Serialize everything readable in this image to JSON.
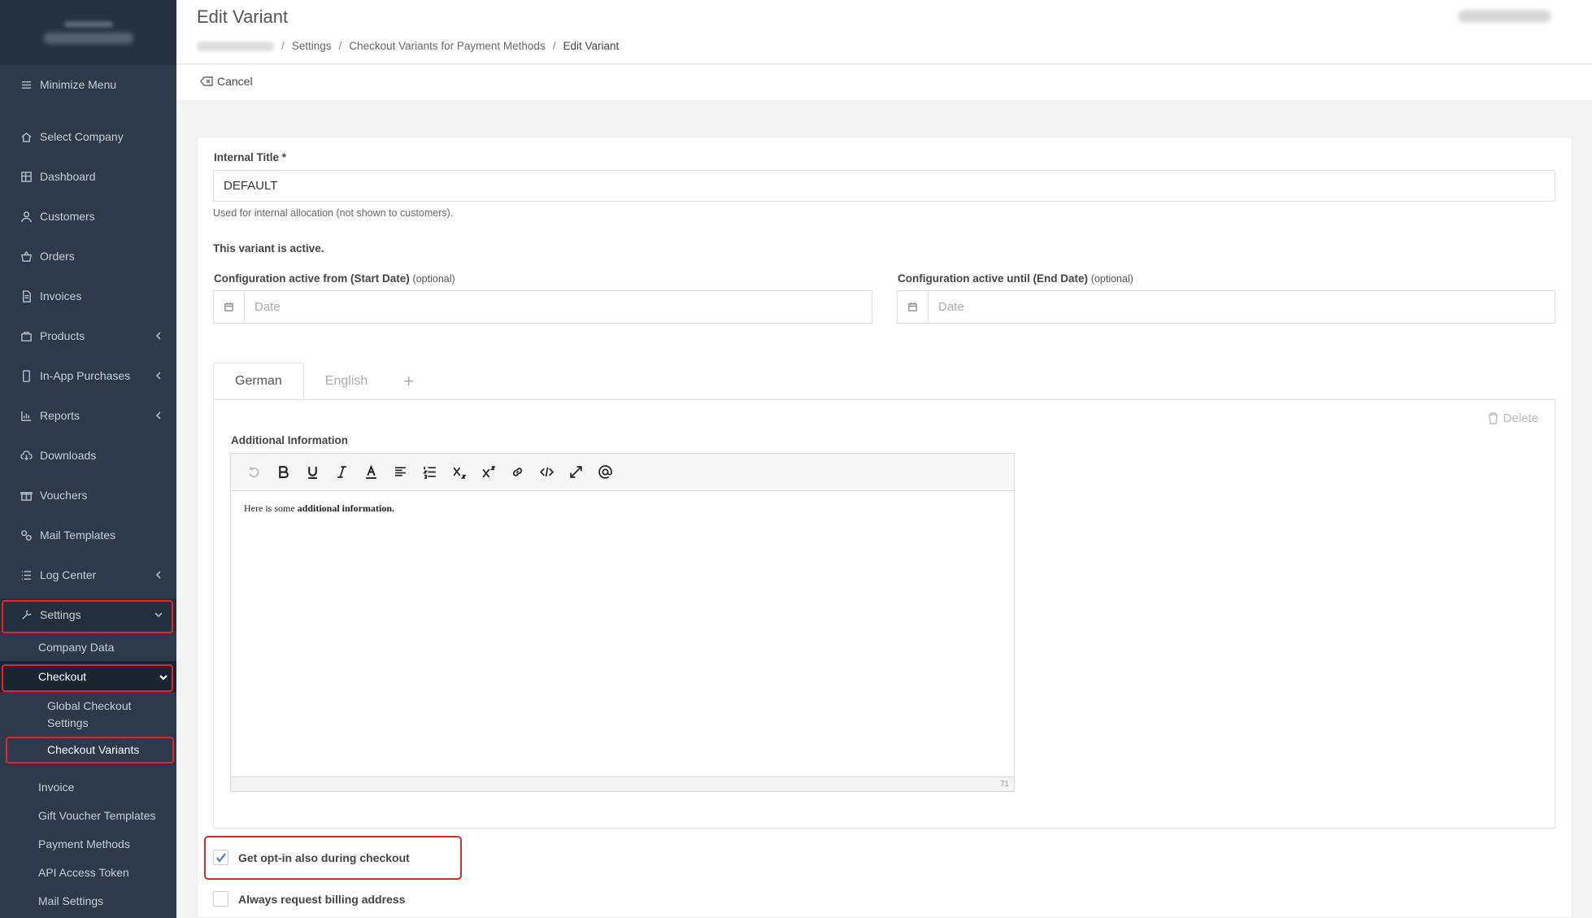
{
  "sidebar": {
    "minimize": "Minimize Menu",
    "items": [
      {
        "label": "Select Company"
      },
      {
        "label": "Dashboard"
      },
      {
        "label": "Customers"
      },
      {
        "label": "Orders"
      },
      {
        "label": "Invoices"
      },
      {
        "label": "Products"
      },
      {
        "label": "In-App Purchases"
      },
      {
        "label": "Reports"
      },
      {
        "label": "Downloads"
      },
      {
        "label": "Vouchers"
      },
      {
        "label": "Mail Templates"
      },
      {
        "label": "Log Center"
      },
      {
        "label": "Settings"
      }
    ],
    "settings_sub": {
      "company_data": "Company Data",
      "checkout": "Checkout",
      "global_checkout": "Global Checkout Settings",
      "checkout_variants": "Checkout Variants",
      "invoice": "Invoice",
      "gift_voucher": "Gift Voucher Templates",
      "payment_methods": "Payment Methods",
      "api_token": "API Access Token",
      "mail_settings": "Mail Settings"
    },
    "highlight_color": "#e0262b"
  },
  "header": {
    "title": "Edit Variant",
    "breadcrumb": {
      "settings": "Settings",
      "checkout_variants": "Checkout Variants for Payment Methods",
      "current": "Edit Variant",
      "sep": "/"
    }
  },
  "actions": {
    "cancel": "Cancel"
  },
  "form": {
    "internal_title_label": "Internal Title *",
    "internal_title_value": "DEFAULT",
    "internal_title_help": "Used for internal allocation (not shown to customers).",
    "active_status": "This variant is active.",
    "start_date_label": "Configuration active from (Start Date)",
    "end_date_label": "Configuration active until (End Date)",
    "optional": "(optional)",
    "date_placeholder": "Date",
    "tabs": [
      "German",
      "English",
      "+"
    ],
    "delete": "Delete",
    "additional_info_label": "Additional Information",
    "editor_text_plain": "Here is some ",
    "editor_text_bold": "additional information.",
    "editor_count": "71",
    "optin_label": "Get opt-in also during checkout",
    "optin_checked": true,
    "billing_label": "Always request billing address",
    "billing_checked": false
  }
}
